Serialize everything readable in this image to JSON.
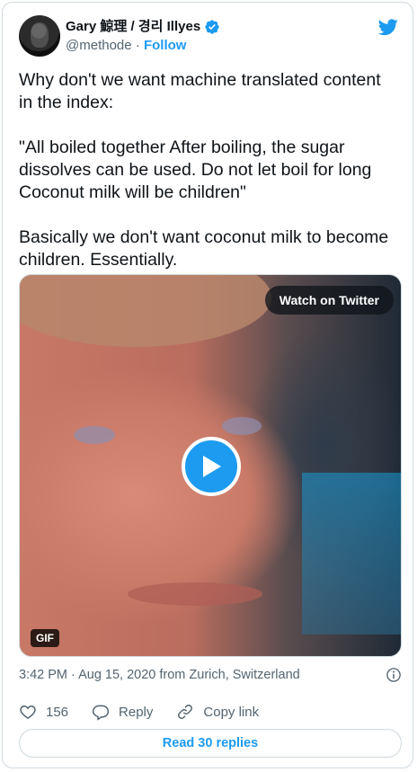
{
  "author": {
    "name": "Gary 鯨理 / 경리 Illyes",
    "handle": "@methode",
    "separator": "·",
    "follow_label": "Follow"
  },
  "tweet": {
    "text": "Why don't we want machine translated content\nin the index:\n\n\"All boiled together After boiling, the sugar\ndissolves can be used. Do not let boil for long\nCoconut milk will be children\"\n\nBasically we don't want coconut milk to become\nchildren. Essentially."
  },
  "media": {
    "watch_label": "Watch on Twitter",
    "gif_badge": "GIF"
  },
  "meta": {
    "timestamp": "3:42 PM · Aug 15, 2020 from Zurich, Switzerland"
  },
  "actions": {
    "like_count": "156",
    "reply_label": "Reply",
    "copy_label": "Copy link"
  },
  "replies_button": "Read 30 replies",
  "colors": {
    "accent": "#1d9bf0",
    "text": "#0f1419",
    "muted": "#536471",
    "border": "#cfd9de"
  },
  "icons": [
    "twitter-bird-icon",
    "verified-badge-icon",
    "play-icon",
    "info-icon",
    "heart-icon",
    "reply-icon",
    "link-icon"
  ]
}
